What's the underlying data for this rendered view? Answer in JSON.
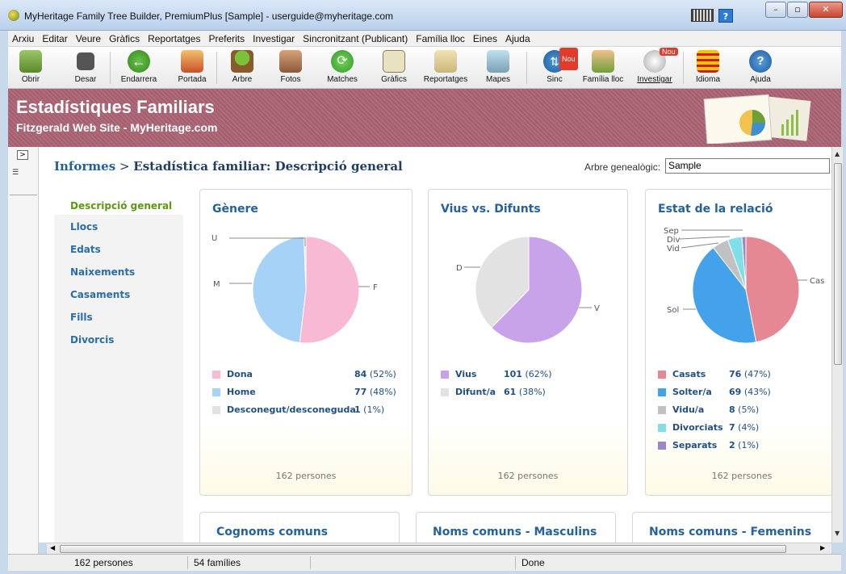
{
  "window": {
    "title": "MyHeritage Family Tree Builder, PremiumPlus [Sample] - userguide@myheritage.com",
    "help_label": "?"
  },
  "menu": [
    "Arxiu",
    "Editar",
    "Veure",
    "Gràfics",
    "Reportatges",
    "Preferits",
    "Investigar",
    "Sincronitzant (Publicant)",
    "Família lloc",
    "Eines",
    "Ajuda"
  ],
  "toolbar": {
    "open": "Obrir",
    "save": "Desar",
    "back": "Endarrera",
    "home": "Portada",
    "tree": "Arbre",
    "photos": "Fotos",
    "matches": "Matches",
    "charts": "Gràfics",
    "reports": "Reportatges",
    "maps": "Mapes",
    "sync": "Sinc",
    "family_site": "Família lloc",
    "research": "Investigar",
    "language": "Idioma",
    "help": "Ajuda",
    "new_badge": "Nou"
  },
  "banner": {
    "title": "Estadístiques Familiars",
    "subtitle": "Fitzgerald Web Site - MyHeritage.com"
  },
  "breadcrumb": {
    "root": "Informes",
    "separator": ">",
    "current": "Estadística familiar: Descripció general"
  },
  "tree_selector": {
    "label": "Arbre genealògic:",
    "value": "Sample"
  },
  "sidenav": [
    "Descripció general",
    "Llocs",
    "Edats",
    "Naixements",
    "Casaments",
    "Fills",
    "Divorcis"
  ],
  "cards": [
    {
      "title": "Gènere",
      "legend": [
        {
          "name": "Dona",
          "count": "84",
          "pct": "(52%)",
          "color": "#f7b9d4"
        },
        {
          "name": "Home",
          "count": "77",
          "pct": "(48%)",
          "color": "#a6d2f7"
        },
        {
          "name": "Desconegut/desconeguda",
          "count": "1",
          "pct": "(1%)",
          "color": "#e2e2e2"
        }
      ],
      "pie_labels": [
        "U",
        "M",
        "F"
      ],
      "total": "162 persones"
    },
    {
      "title": "Vius vs. Difunts",
      "legend": [
        {
          "name": "Vius",
          "count": "101",
          "pct": "(62%)",
          "color": "#c9a3ea"
        },
        {
          "name": "Difunt/a",
          "count": "61",
          "pct": "(38%)",
          "color": "#e2e2e2"
        }
      ],
      "pie_labels": [
        "D",
        "V"
      ],
      "total": "162 persones"
    },
    {
      "title": "Estat de la relació",
      "legend": [
        {
          "name": "Casats",
          "count": "76",
          "pct": "(47%)",
          "color": "#e58893"
        },
        {
          "name": "Solter/a",
          "count": "69",
          "pct": "(43%)",
          "color": "#43a2ea"
        },
        {
          "name": "Vidu/a",
          "count": "8",
          "pct": "(5%)",
          "color": "#c1c1c1"
        },
        {
          "name": "Divorciats",
          "count": "7",
          "pct": "(4%)",
          "color": "#7edfe8"
        },
        {
          "name": "Separats",
          "count": "2",
          "pct": "(1%)",
          "color": "#9a86c8"
        }
      ],
      "pie_labels": [
        "Sep",
        "Div",
        "Vid",
        "Sol",
        "Cas"
      ],
      "total": "162 persones"
    }
  ],
  "lower_cards": [
    "Cognoms comuns",
    "Noms comuns - Masculins",
    "Noms comuns - Femenins"
  ],
  "status": {
    "people": "162 persones",
    "families": "54 famílies",
    "state": "Done"
  },
  "chart_data": [
    {
      "type": "pie",
      "title": "Gènere",
      "categories": [
        "Dona",
        "Home",
        "Desconegut/desconeguda"
      ],
      "values": [
        84,
        77,
        1
      ]
    },
    {
      "type": "pie",
      "title": "Vius vs. Difunts",
      "categories": [
        "Vius",
        "Difunt/a"
      ],
      "values": [
        101,
        61
      ]
    },
    {
      "type": "pie",
      "title": "Estat de la relació",
      "categories": [
        "Casats",
        "Solter/a",
        "Vidu/a",
        "Divorciats",
        "Separats"
      ],
      "values": [
        76,
        69,
        8,
        7,
        2
      ]
    }
  ]
}
